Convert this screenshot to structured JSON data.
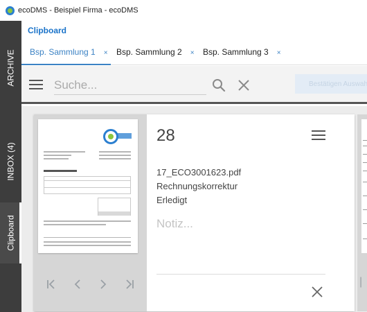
{
  "window": {
    "title": "ecoDMS - Beispiel Firma - ecoDMS"
  },
  "sidebar": {
    "tabs": [
      {
        "label": "ARCHIVE"
      },
      {
        "label": "INBOX (4)"
      },
      {
        "label": "Clipboard",
        "active": true
      }
    ]
  },
  "clipboard": {
    "title": "Clipboard",
    "collections": [
      {
        "label": "Bsp. Sammlung 1",
        "active": true
      },
      {
        "label": "Bsp. Sammlung 2"
      },
      {
        "label": "Bsp. Sammlung 3"
      }
    ],
    "tab_close_glyph": "×",
    "search": {
      "placeholder": "Suche...",
      "value": ""
    },
    "confirm_button_label": "Bestätigen Auswahl"
  },
  "document_card": {
    "number": "28",
    "filename": "17_ECO3001623.pdf",
    "document_type": "Rechnungskorrektur",
    "status": "Erledigt",
    "note_placeholder": "Notiz...",
    "thumbnail": {
      "brand": "ecoDMS",
      "heading": "Rechnungskorrektur 31478"
    },
    "pager_icons": [
      "first-page-icon",
      "previous-page-icon",
      "next-page-icon",
      "last-page-icon"
    ]
  },
  "colors": {
    "accent": "#3b82c4",
    "rail": "#3d3d3d",
    "content_background": "#ececec",
    "searchbar_background": "#f3f3f3"
  }
}
